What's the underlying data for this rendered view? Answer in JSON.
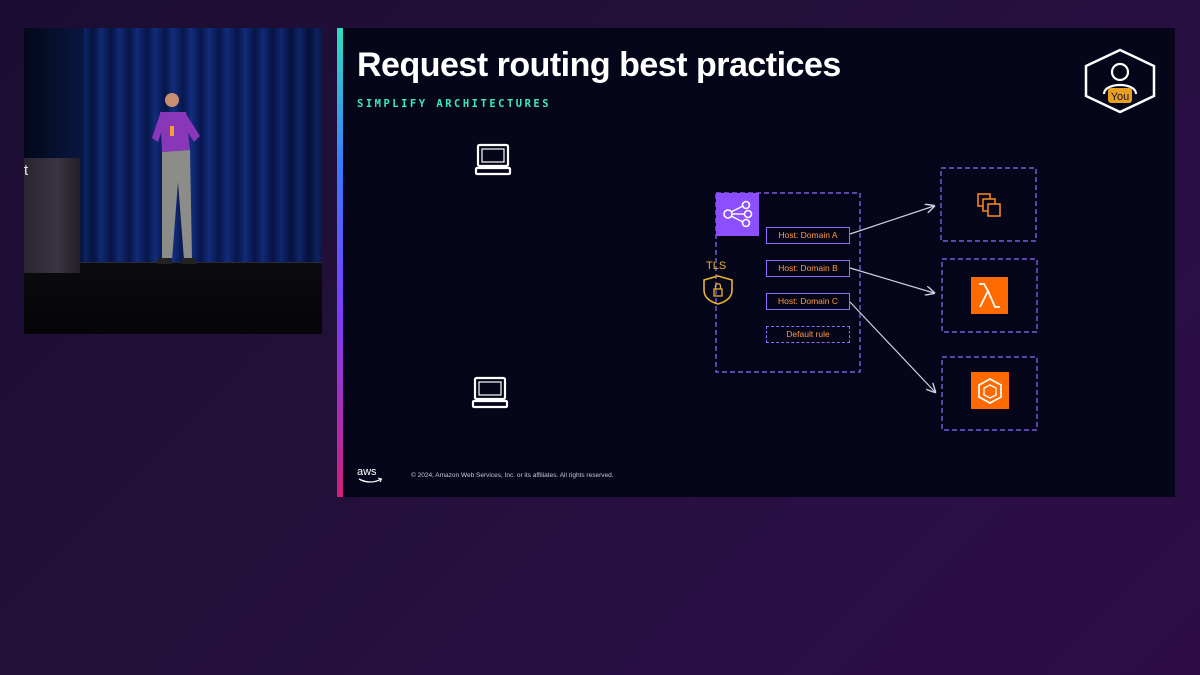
{
  "video": {
    "podium_letter": "t"
  },
  "slide": {
    "title": "Request routing best practices",
    "subtitle": "SIMPLIFY ARCHITECTURES",
    "footer": "© 2024, Amazon Web Services, Inc. or its affiliates. All rights reserved.",
    "logo_text": "aws",
    "you_badge": "You"
  },
  "diagram": {
    "tls_label": "TLS",
    "rules": [
      {
        "label": "Host: Domain A"
      },
      {
        "label": "Host: Domain B"
      },
      {
        "label": "Host: Domain C"
      },
      {
        "label": "Default rule"
      }
    ],
    "targets": [
      {
        "icon": "ec2-instances-icon"
      },
      {
        "icon": "lambda-icon"
      },
      {
        "icon": "ecs-icon"
      }
    ]
  },
  "colors": {
    "accent_purple": "#8f6bff",
    "aws_orange": "#ff6a00",
    "rule_text": "#ff9a3c",
    "subtitle_teal": "#3de8c0",
    "tls_gold": "#e8b22e"
  }
}
